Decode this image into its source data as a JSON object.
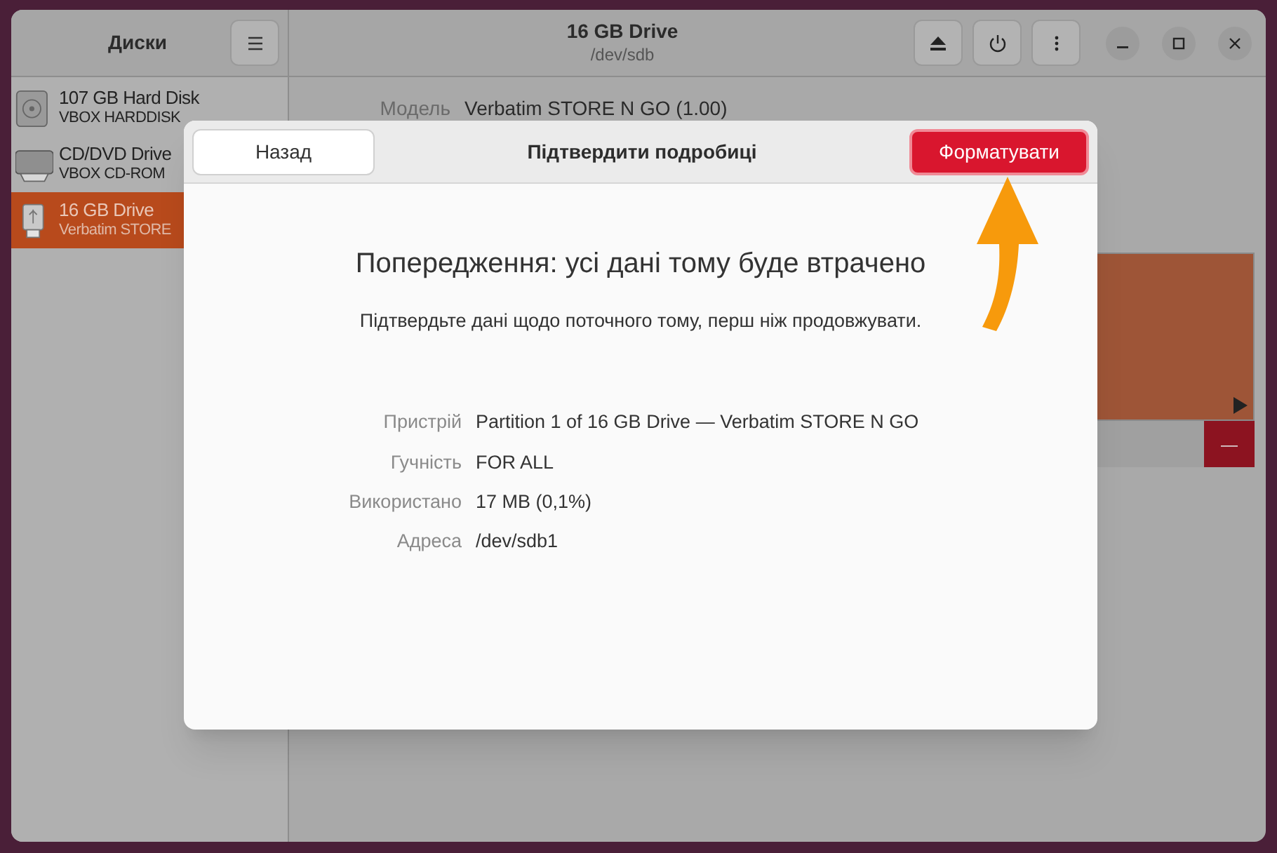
{
  "sidebar": {
    "title": "Диски",
    "items": [
      {
        "name": "107 GB Hard Disk",
        "detail": "VBOX HARDDISK",
        "kind": "hdd",
        "selected": false
      },
      {
        "name": "CD/DVD Drive",
        "detail": "VBOX CD-ROM",
        "kind": "optical",
        "selected": false
      },
      {
        "name": "16 GB Drive",
        "detail": "Verbatim STORE",
        "kind": "usb",
        "selected": true
      }
    ]
  },
  "header": {
    "title": "16 GB Drive",
    "subtitle": "/dev/sdb"
  },
  "drive_info": [
    {
      "label": "Модель",
      "value": "Verbatim STORE N GO (1.00)"
    }
  ],
  "volume_panel": {
    "minus_button": "—"
  },
  "dialog": {
    "back_button": "Назад",
    "title": "Підтвердити подробиці",
    "format_button": "Форматувати",
    "heading": "Попередження: усі дані тому буде втрачено",
    "message": "Підтвердьте дані щодо поточного тому, перш ніж продовжувати.",
    "details": [
      {
        "label": "Пристрій",
        "value": "Partition 1 of 16 GB Drive — Verbatim STORE N GO"
      },
      {
        "label": "Гучність",
        "value": "FOR ALL"
      },
      {
        "label": "Використано",
        "value": "17 MB (0,1%)"
      },
      {
        "label": "Адреса",
        "value": "/dev/sdb1"
      }
    ]
  }
}
